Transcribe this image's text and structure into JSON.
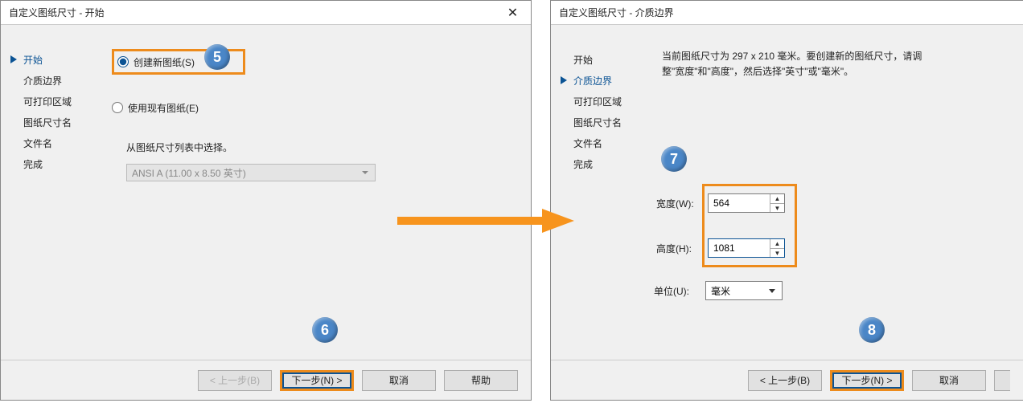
{
  "dialogs": {
    "left": {
      "title": "自定义图纸尺寸 - 开始",
      "nav": [
        "开始",
        "介质边界",
        "可打印区域",
        "图纸尺寸名",
        "文件名",
        "完成"
      ],
      "nav_active_index": 0,
      "radio1": "创建新图纸(S)",
      "radio2": "使用现有图纸(E)",
      "hint": "从图纸尺寸列表中选择。",
      "combo": "ANSI A (11.00 x 8.50 英寸)",
      "buttons": {
        "back": "< 上一步(B)",
        "next": "下一步(N) >",
        "cancel": "取消",
        "help": "帮助"
      }
    },
    "right": {
      "title": "自定义图纸尺寸 - 介质边界",
      "nav": [
        "开始",
        "介质边界",
        "可打印区域",
        "图纸尺寸名",
        "文件名",
        "完成"
      ],
      "nav_active_index": 1,
      "descr": "当前图纸尺寸为 297 x 210 毫米。要创建新的图纸尺寸，请调整\"宽度\"和\"高度\"，然后选择\"英寸\"或\"毫米\"。",
      "width_label": "宽度(W):",
      "width_value": "564",
      "height_label": "高度(H):",
      "height_value": "1081",
      "unit_label": "单位(U):",
      "unit_value": "毫米",
      "buttons": {
        "back": "< 上一步(B)",
        "next": "下一步(N) >",
        "cancel": "取消"
      }
    }
  },
  "callouts": {
    "c5": "5",
    "c6": "6",
    "c7": "7",
    "c8": "8"
  }
}
